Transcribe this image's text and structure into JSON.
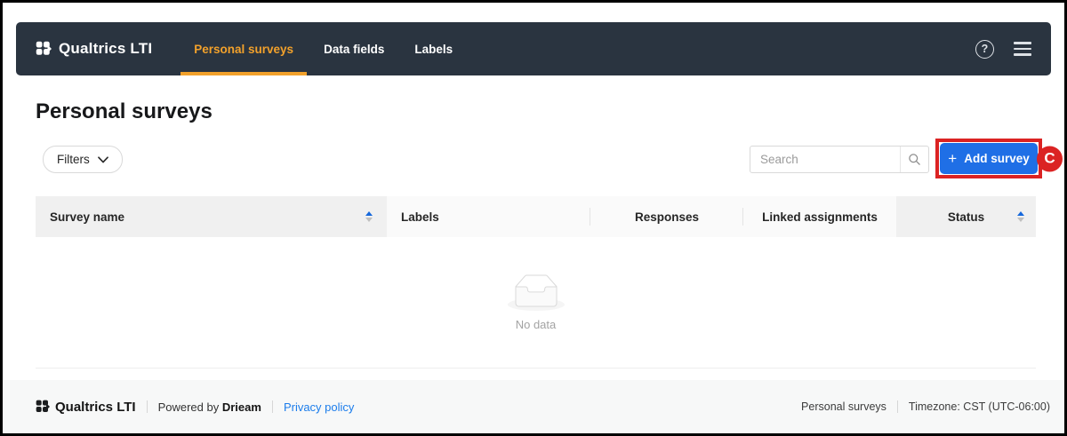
{
  "navbar": {
    "brand": "Qualtrics LTI",
    "tabs": [
      {
        "label": "Personal surveys",
        "active": true
      },
      {
        "label": "Data fields",
        "active": false
      },
      {
        "label": "Labels",
        "active": false
      }
    ],
    "help_glyph": "?"
  },
  "page": {
    "title": "Personal surveys"
  },
  "toolbar": {
    "filters_label": "Filters",
    "search_placeholder": "Search",
    "add_survey_label": "Add survey",
    "plus_glyph": "+",
    "annotation_letter": "C"
  },
  "table": {
    "columns": [
      {
        "label": "Survey name",
        "sortable": true,
        "sorted": "asc"
      },
      {
        "label": "Labels",
        "sortable": false
      },
      {
        "label": "Responses",
        "sortable": false
      },
      {
        "label": "Linked assignments",
        "sortable": false
      },
      {
        "label": "Status",
        "sortable": true,
        "sorted": "asc"
      }
    ],
    "rows": [],
    "empty_text": "No data"
  },
  "footer": {
    "brand": "Qualtrics LTI",
    "powered_by_prefix": "Powered by",
    "powered_by_name": "Drieam",
    "privacy_link": "Privacy policy",
    "page_context": "Personal surveys",
    "timezone": "Timezone: CST (UTC-06:00)"
  },
  "icons": {
    "brand_logo": "drieam-waffle-arrow",
    "help": "question-circle",
    "menu": "hamburger",
    "filters": "chevron-down",
    "search": "magnifier",
    "sort": "caret-up-down",
    "empty": "inbox"
  },
  "colors": {
    "navbar_bg": "#2A3440",
    "accent_orange": "#F2A12B",
    "primary_blue": "#1F6FE6",
    "annotation_red": "#DB2323",
    "link_blue": "#1C7DEB",
    "sort_active_blue": "#1668DC",
    "header_bg_sortable": "#F0F0F0",
    "header_bg": "#FAFAFA",
    "footer_bg": "#F7F8F8"
  }
}
